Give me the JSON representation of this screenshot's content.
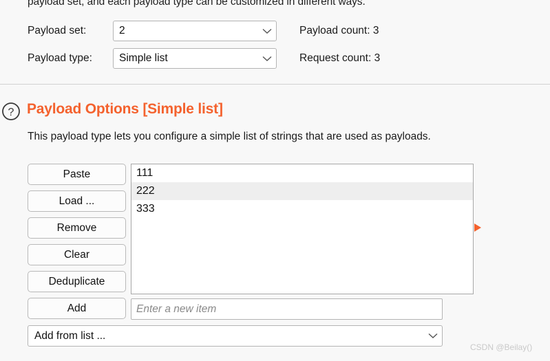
{
  "intro": {
    "clipped_text": "payload set, and each payload type can be customized in different ways."
  },
  "payload_config": {
    "set_label": "Payload set:",
    "set_value": "2",
    "type_label": "Payload type:",
    "type_value": "Simple list",
    "payload_count": "Payload count: 3",
    "request_count": "Request count: 3"
  },
  "options_section": {
    "help_icon": "question-circle-icon",
    "title": "Payload Options [Simple list]",
    "description": "This payload type lets you configure a simple list of strings that are used as payloads.",
    "accent_color": "#f4622e"
  },
  "buttons": [
    {
      "label": "Paste",
      "name": "paste-button"
    },
    {
      "label": "Load ...",
      "name": "load-button"
    },
    {
      "label": "Remove",
      "name": "remove-button"
    },
    {
      "label": "Clear",
      "name": "clear-button"
    },
    {
      "label": "Deduplicate",
      "name": "deduplicate-button"
    },
    {
      "label": "Add",
      "name": "add-button"
    }
  ],
  "payload_list": {
    "items": [
      {
        "value": "111",
        "selected": false
      },
      {
        "value": "222",
        "selected": true
      },
      {
        "value": "333",
        "selected": false
      }
    ]
  },
  "new_item": {
    "value": "",
    "placeholder": "Enter a new item"
  },
  "add_from_list": {
    "value": "Add from list ...",
    "icon": "chevron-down-icon"
  },
  "expander": {
    "icon": "triangle-right-icon",
    "color": "#f4622e"
  },
  "watermark": {
    "text": "CSDN @Beilay()"
  }
}
